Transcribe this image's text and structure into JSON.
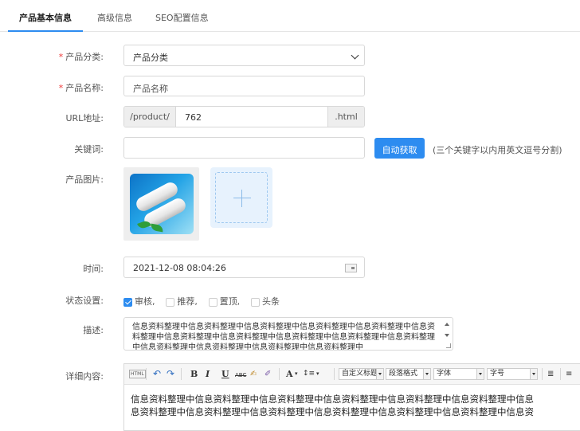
{
  "tabs": [
    {
      "label": "产品基本信息",
      "active": true
    },
    {
      "label": "高级信息",
      "active": false
    },
    {
      "label": "SEO配置信息",
      "active": false
    }
  ],
  "form": {
    "category": {
      "label": "产品分类:",
      "required_mark": "*",
      "value": "产品分类"
    },
    "name": {
      "label": "产品名称:",
      "required_mark": "*",
      "placeholder": "产品名称"
    },
    "url": {
      "label": "URL地址:",
      "prefix": "/product/",
      "value": "762",
      "suffix": ".html"
    },
    "keywords": {
      "label": "关键词:",
      "value": "",
      "button": "自动获取",
      "hint": "(三个关键字以内用英文逗号分割)"
    },
    "images": {
      "label": "产品图片:"
    },
    "time": {
      "label": "时间:",
      "value": "2021-12-08 08:04:26"
    },
    "status": {
      "label": "状态设置:",
      "options": [
        {
          "label": "审核,",
          "checked": true
        },
        {
          "label": "推荐,",
          "checked": false
        },
        {
          "label": "置顶,",
          "checked": false
        },
        {
          "label": "头条",
          "checked": false
        }
      ]
    },
    "description": {
      "label": "描述:",
      "value": "信息资料整理中信息资料整理中信息资料整理中信息资料整理中信息资料整理中信息资料整理中信息资料整理中信息资料整理中信息资料整理中信息资料整理中信息资料整理中信息资料整理中信息资料整理中信息资料整理中信息资料整理中"
    },
    "content": {
      "label": "详细内容:",
      "toolbar": {
        "html": "HTML",
        "undo": "↶",
        "redo": "↷",
        "bold": "B",
        "italic": "I",
        "underline": "U",
        "strike": "ABC",
        "font_color": "A",
        "line_height": "↕≡",
        "custom_title": "自定义标题",
        "paragraph": "段落格式",
        "font_family": "字体",
        "font_size": "字号"
      },
      "lines": [
        "信息资料整理中信息资料整理中信息资料整理中信息资料整理中信息资料整理中信息资料整理中信息",
        "息资料整理中信息资料整理中信息资料整理中信息资料整理中信息资料整理中信息资料整理中信息资"
      ]
    }
  },
  "colors": {
    "accent": "#2d8cf0",
    "required": "#e33333"
  }
}
